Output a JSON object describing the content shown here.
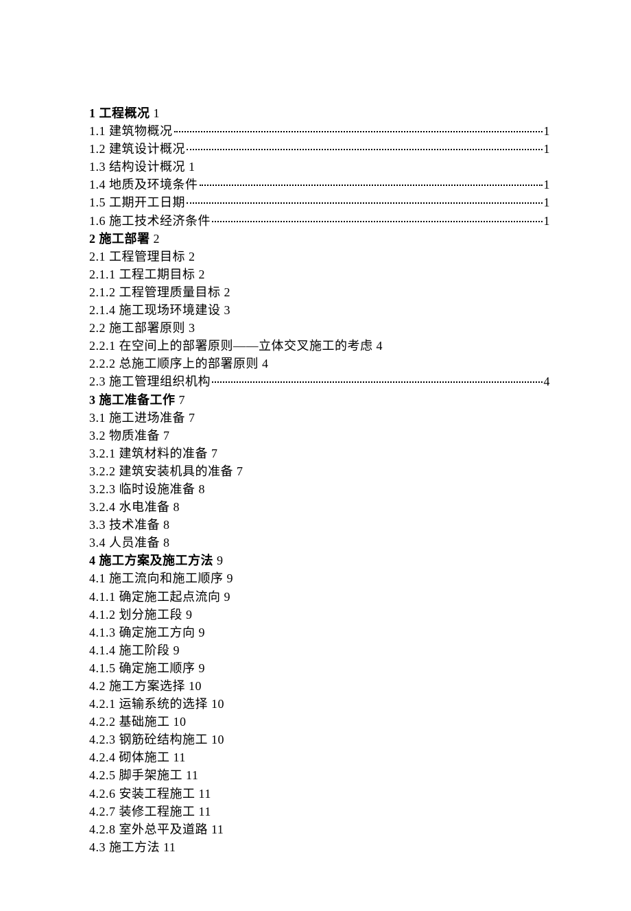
{
  "toc": [
    {
      "prefix": "1 ",
      "bold": true,
      "title": "工程概况",
      "page": "1",
      "leader": false,
      "gapAfter": false
    },
    {
      "prefix": "1.1 ",
      "bold": false,
      "title": "建筑物概况",
      "page": "1",
      "leader": true,
      "gapAfter": false
    },
    {
      "prefix": "1.2 ",
      "bold": false,
      "title": "建筑设计概况",
      "page": "1",
      "leader": true,
      "gapAfter": false
    },
    {
      "prefix": "1.3 ",
      "bold": false,
      "title": "结构设计概况",
      "page": "1",
      "leader": false,
      "gapAfter": false
    },
    {
      "prefix": "1.4 ",
      "bold": false,
      "title": "地质及环境条件",
      "page": "1",
      "leader": true,
      "gapAfter": false
    },
    {
      "prefix": "1.5 ",
      "bold": false,
      "title": "工期开工日期",
      "page": "1",
      "leader": true,
      "gapAfter": false
    },
    {
      "prefix": "1.6 ",
      "bold": false,
      "title": "施工技术经济条件",
      "page": "1",
      "leader": true,
      "gapAfter": false
    },
    {
      "prefix": "2 ",
      "bold": true,
      "title": "施工部署",
      "page": "2",
      "leader": false,
      "gapAfter": false
    },
    {
      "prefix": "2.1 ",
      "bold": false,
      "title": "工程管理目标",
      "page": "2",
      "leader": false,
      "gapAfter": false
    },
    {
      "prefix": "2.1.1  ",
      "bold": false,
      "title": "工程工期目标",
      "page": "2",
      "leader": false,
      "gapAfter": false
    },
    {
      "prefix": "2.1.2 ",
      "bold": false,
      "title": "工程管理质量目标",
      "page": "2",
      "leader": false,
      "gapAfter": false
    },
    {
      "prefix": "2.1.4 ",
      "bold": false,
      "title": "施工现场环境建设",
      "page": "3",
      "leader": false,
      "gapAfter": false
    },
    {
      "prefix": "2.2 ",
      "bold": false,
      "title": "施工部署原则",
      "page": "3",
      "leader": false,
      "gapAfter": false
    },
    {
      "prefix": "2.2.1 ",
      "bold": false,
      "title": "在空间上的部署原则——立体交叉施工的考虑",
      "page": "4",
      "leader": false,
      "gapAfter": false
    },
    {
      "prefix": "2.2.2 ",
      "bold": false,
      "title": "总施工顺序上的部署原则",
      "page": "4",
      "leader": false,
      "gapAfter": false
    },
    {
      "prefix": "2.3 ",
      "bold": false,
      "title": "施工管理组织机构",
      "page": "4",
      "leader": true,
      "gapAfter": false
    },
    {
      "prefix": "3 ",
      "bold": true,
      "title": "施工准备工作",
      "page": "7",
      "leader": false,
      "gapAfter": false
    },
    {
      "prefix": "3.1  ",
      "bold": false,
      "title": "施工进场准备",
      "page": "7",
      "leader": false,
      "gapAfter": false
    },
    {
      "prefix": "3.2 ",
      "bold": false,
      "title": "物质准备",
      "page": "7",
      "leader": false,
      "gapAfter": false
    },
    {
      "prefix": "3.2.1  ",
      "bold": false,
      "title": "建筑材料的准备",
      "page": "7",
      "leader": false,
      "gapAfter": false
    },
    {
      "prefix": "3.2.2 ",
      "bold": false,
      "title": "建筑安装机具的准备",
      "page": "7",
      "leader": false,
      "gapAfter": false
    },
    {
      "prefix": "3.2.3 ",
      "bold": false,
      "title": "临时设施准备",
      "page": "8",
      "leader": false,
      "gapAfter": false
    },
    {
      "prefix": "3.2.4 ",
      "bold": false,
      "title": "水电准备",
      "page": "8",
      "leader": false,
      "gapAfter": false
    },
    {
      "prefix": "3.3 ",
      "bold": false,
      "title": "技术准备",
      "page": "8",
      "leader": false,
      "gapAfter": false
    },
    {
      "prefix": "3.4 ",
      "bold": false,
      "title": "人员准备",
      "page": "8",
      "leader": false,
      "gapAfter": false
    },
    {
      "prefix": "4 ",
      "bold": true,
      "title": "施工方案及施工方法",
      "page": "9",
      "leader": false,
      "gapAfter": false
    },
    {
      "prefix": "4.1 ",
      "bold": false,
      "title": "施工流向和施工顺序",
      "page": "9",
      "leader": false,
      "gapAfter": false
    },
    {
      "prefix": "4.1.1 ",
      "bold": false,
      "title": "确定施工起点流向",
      "page": "9",
      "leader": false,
      "gapAfter": false
    },
    {
      "prefix": "4.1.2 ",
      "bold": false,
      "title": "划分施工段",
      "page": "9",
      "leader": false,
      "gapAfter": false
    },
    {
      "prefix": "4.1.3 ",
      "bold": false,
      "title": "确定施工方向",
      "page": "9",
      "leader": false,
      "gapAfter": false
    },
    {
      "prefix": "4.1.4 ",
      "bold": false,
      "title": "施工阶段",
      "page": "9",
      "leader": false,
      "gapAfter": false
    },
    {
      "prefix": "4.1.5 ",
      "bold": false,
      "title": "确定施工顺序",
      "page": "9",
      "leader": false,
      "gapAfter": false
    },
    {
      "prefix": "4.2 ",
      "bold": false,
      "title": "施工方案选择",
      "page": "10",
      "leader": false,
      "gapAfter": false
    },
    {
      "prefix": "4.2.1 ",
      "bold": false,
      "title": "运输系统的选择",
      "page": "10",
      "leader": false,
      "gapAfter": false
    },
    {
      "prefix": "4.2.2 ",
      "bold": false,
      "title": "基础施工",
      "page": "10",
      "leader": false,
      "gapAfter": false
    },
    {
      "prefix": "4.2.3 ",
      "bold": false,
      "title": "钢筋砼结构施工",
      "page": "10",
      "leader": false,
      "gapAfter": false
    },
    {
      "prefix": "4.2.4 ",
      "bold": false,
      "title": "砌体施工",
      "page": "11",
      "leader": false,
      "gapAfter": false
    },
    {
      "prefix": "4.2.5 ",
      "bold": false,
      "title": "脚手架施工",
      "page": "11",
      "leader": false,
      "gapAfter": false
    },
    {
      "prefix": "4.2.6 ",
      "bold": false,
      "title": "安装工程施工",
      "page": "11",
      "leader": false,
      "gapAfter": false
    },
    {
      "prefix": "4.2.7 ",
      "bold": false,
      "title": "装修工程施工",
      "page": "11",
      "leader": false,
      "gapAfter": false
    },
    {
      "prefix": "4.2.8 ",
      "bold": false,
      "title": "室外总平及道路",
      "page": "11",
      "leader": false,
      "gapAfter": false
    },
    {
      "prefix": "4.3  ",
      "bold": false,
      "title": "施工方法",
      "page": "11",
      "leader": false,
      "gapAfter": false
    }
  ]
}
